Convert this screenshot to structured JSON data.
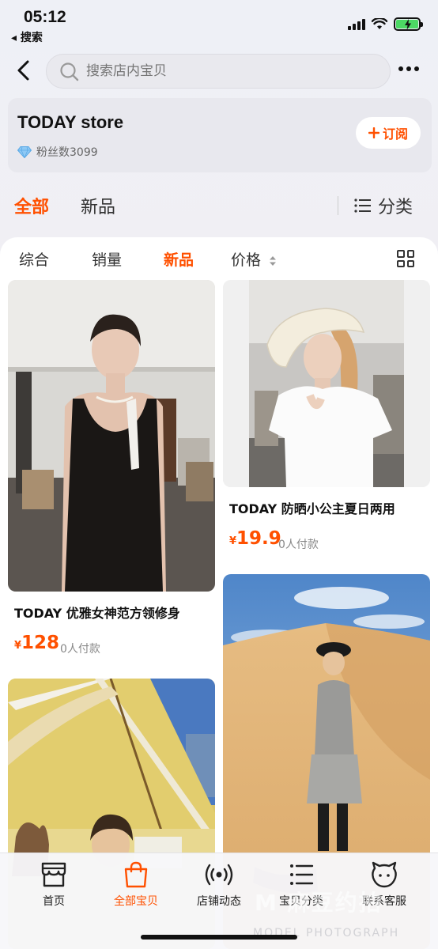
{
  "status_bar": {
    "time": "05:12",
    "back_app": "◂ 搜索"
  },
  "search": {
    "placeholder": "搜索店内宝贝"
  },
  "store": {
    "name": "TODAY store",
    "fans": "粉丝数3099",
    "subscribe_label": "订阅"
  },
  "category_tabs": {
    "all": "全部",
    "new": "新品",
    "categories": "分类"
  },
  "sort_bar": {
    "general": "综合",
    "sales": "销量",
    "new": "新品",
    "price": "价格"
  },
  "products": [
    {
      "title": "TODAY 优雅女神范方领修身",
      "currency": "¥",
      "price": "128",
      "sold": "0人付款"
    },
    {
      "title": "TODAY 防晒小公主夏日两用",
      "currency": "¥",
      "price": "19.9",
      "sold": "0人付款"
    },
    {
      "title": "",
      "currency": "",
      "price": "",
      "sold": ""
    },
    {
      "title": "",
      "currency": "",
      "price": "",
      "sold": ""
    }
  ],
  "bottom_nav": [
    {
      "label": "首页",
      "icon": "storefront-icon"
    },
    {
      "label": "全部宝贝",
      "icon": "shopping-bag-icon"
    },
    {
      "label": "店铺动态",
      "icon": "broadcast-icon"
    },
    {
      "label": "宝贝分类",
      "icon": "list-icon"
    },
    {
      "label": "联系客服",
      "icon": "chat-face-icon"
    }
  ],
  "watermark": {
    "main": "M 麻豆约拍",
    "sub": "MODEL PHOTOGRAPH"
  },
  "colors": {
    "accent": "#ff5000",
    "background": "#f1f0f4",
    "battery": "#4cd964"
  }
}
